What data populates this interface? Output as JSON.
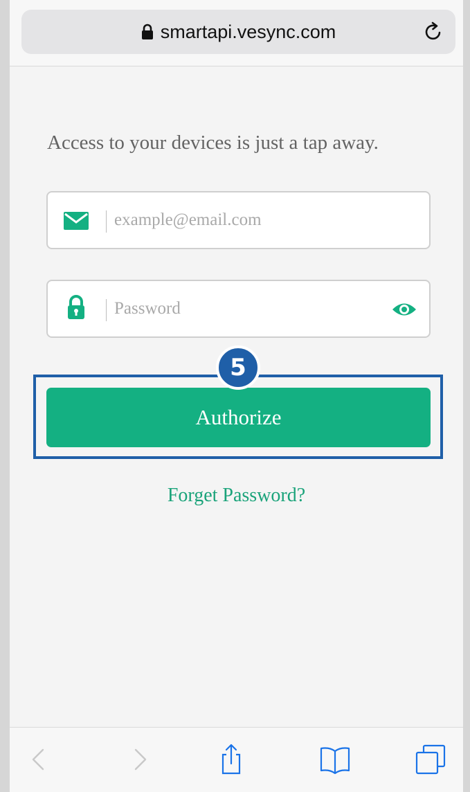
{
  "browser": {
    "url": "smartapi.vesync.com",
    "icons": {
      "lock": "lock-icon",
      "reload": "reload-icon"
    }
  },
  "login": {
    "tagline": "Access to your devices is just a tap away.",
    "email": {
      "value": "",
      "placeholder": "example@email.com",
      "icon": "envelope-icon"
    },
    "password": {
      "value": "",
      "placeholder": "Password",
      "icon": "padlock-icon",
      "toggle_icon": "eye-icon"
    },
    "authorize_label": "Authorize",
    "forgot_label": "Forget Password?"
  },
  "annotation": {
    "step_number": "5"
  },
  "toolbar": {
    "items": [
      "back-icon",
      "forward-icon",
      "share-icon",
      "bookmarks-icon",
      "tabs-icon"
    ]
  },
  "colors": {
    "accent": "#14b082",
    "link": "#1aa37a",
    "highlight": "#1f5fa8"
  }
}
